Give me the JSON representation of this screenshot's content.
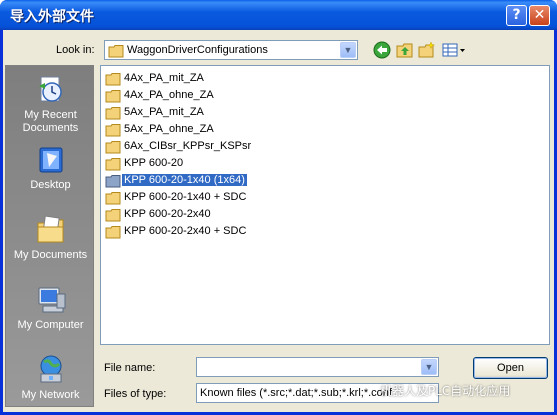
{
  "window": {
    "title": "导入外部文件",
    "help_label": "?",
    "close_label": "✕"
  },
  "lookin": {
    "label": "Look in:",
    "value": "WaggonDriverConfigurations"
  },
  "toolbar": {
    "icons": [
      "back-icon",
      "up-folder-icon",
      "new-folder-icon",
      "view-menu-icon"
    ]
  },
  "places": [
    {
      "label": "My Recent\nDocuments",
      "icon": "recent-documents-icon"
    },
    {
      "label": "Desktop",
      "icon": "desktop-icon"
    },
    {
      "label": "My Documents",
      "icon": "my-documents-icon"
    },
    {
      "label": "My Computer",
      "icon": "my-computer-icon"
    },
    {
      "label": "My Network",
      "icon": "my-network-icon"
    }
  ],
  "files": [
    {
      "name": "4Ax_PA_mit_ZA",
      "selected": false
    },
    {
      "name": "4Ax_PA_ohne_ZA",
      "selected": false
    },
    {
      "name": "5Ax_PA_mit_ZA",
      "selected": false
    },
    {
      "name": "5Ax_PA_ohne_ZA",
      "selected": false
    },
    {
      "name": "6Ax_CIBsr_KPPsr_KSPsr",
      "selected": false
    },
    {
      "name": "KPP 600-20",
      "selected": false
    },
    {
      "name": "KPP 600-20-1x40 (1x64)",
      "selected": true
    },
    {
      "name": "KPP 600-20-1x40 + SDC",
      "selected": false
    },
    {
      "name": "KPP 600-20-2x40",
      "selected": false
    },
    {
      "name": "KPP 600-20-2x40 + SDC",
      "selected": false
    }
  ],
  "filename": {
    "label": "File name:",
    "value": ""
  },
  "filetype": {
    "label": "Files of type:",
    "value": "Known files (*.src;*.dat;*.sub;*.krl;*.conf"
  },
  "buttons": {
    "open": "Open"
  },
  "watermark": "机器人及PLC自动化应用",
  "colors": {
    "titlebar": "#0a5ae0",
    "selection": "#316ac5",
    "dialog_bg": "#ece9d8",
    "places_bar": "#8d8d8d"
  }
}
